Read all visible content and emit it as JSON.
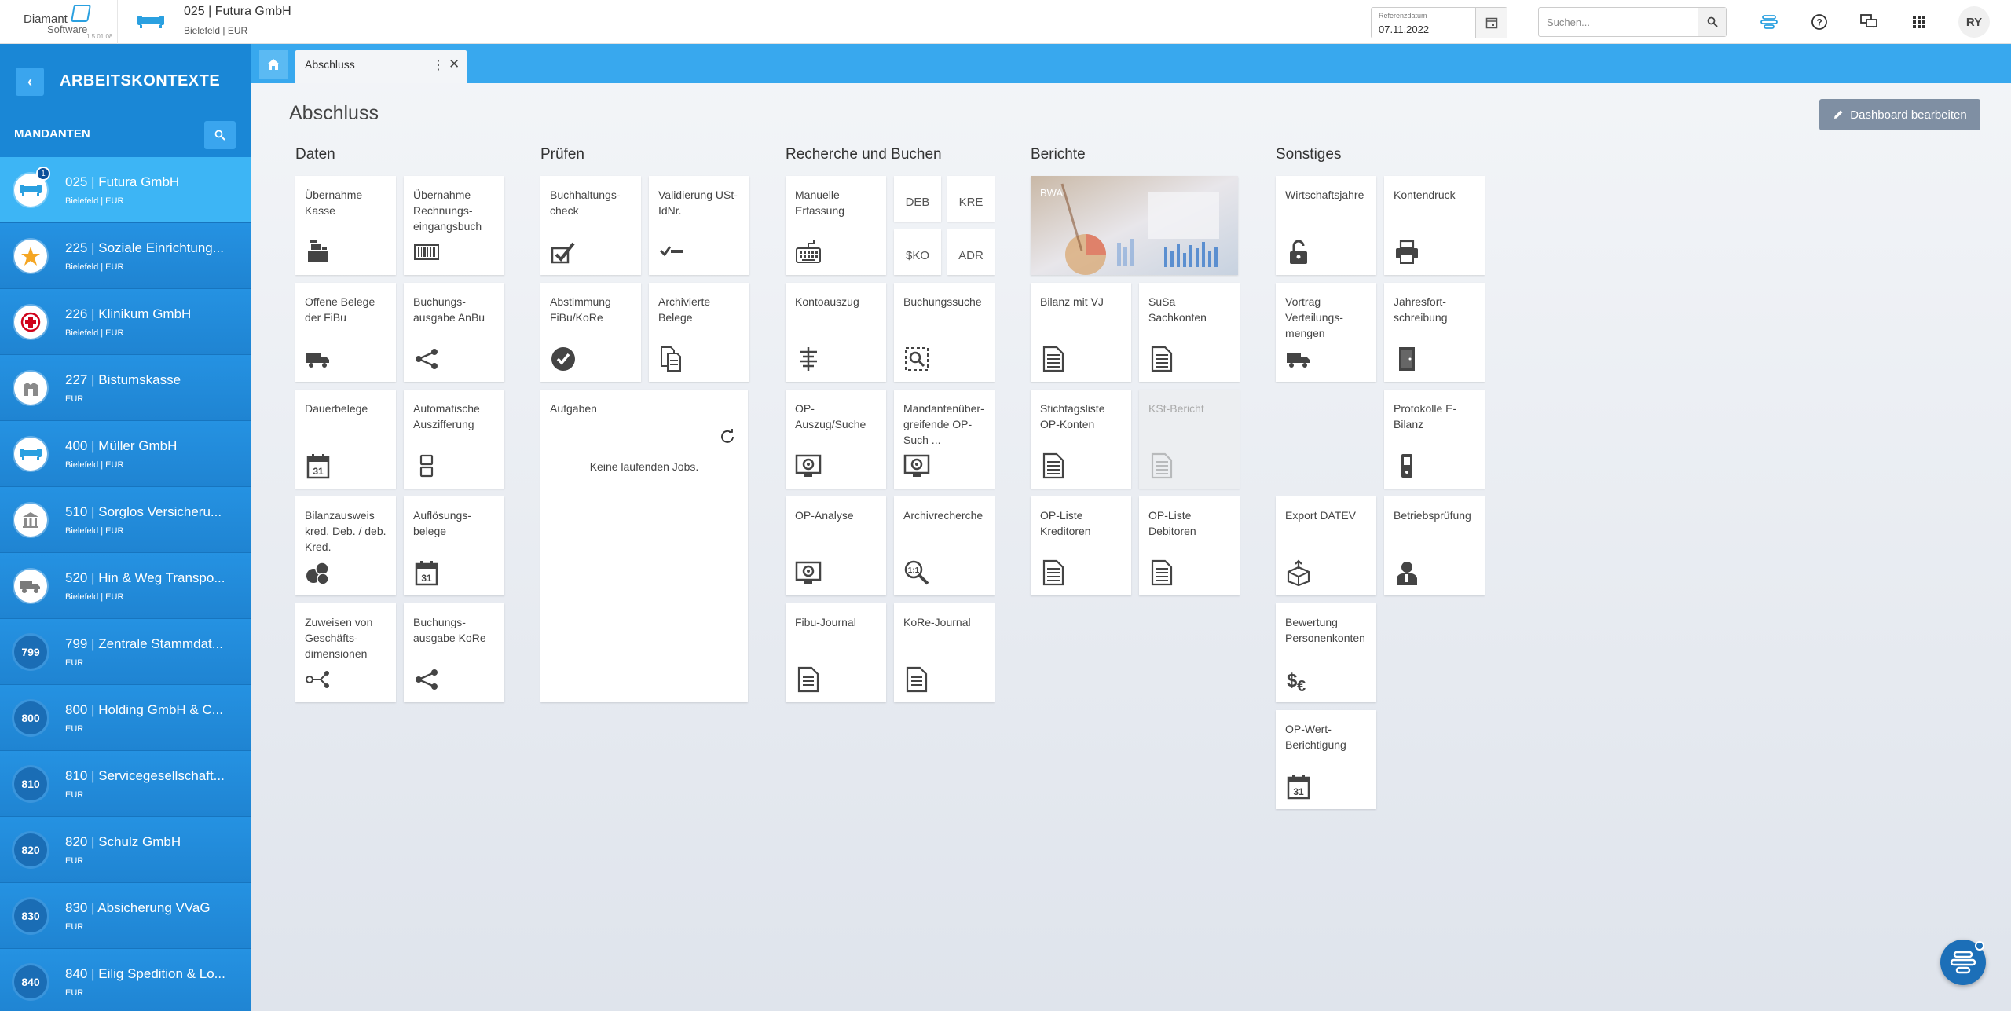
{
  "topbar": {
    "logo_line1": "Diamant",
    "logo_line2": "Software",
    "version": "1.5.01.08",
    "context_name": "025 | Futura GmbH",
    "context_sub": "Bielefeld | EUR",
    "ref_date_label": "Referenzdatum",
    "ref_date_value": "07.11.2022",
    "search_placeholder": "Suchen...",
    "avatar": "RY"
  },
  "sidebar": {
    "title": "ARBEITSKONTEXTE",
    "section": "MANDANTEN",
    "items": [
      {
        "label": "025 | Futura GmbH",
        "sub": "Bielefeld | EUR",
        "icon": "sofa-icon",
        "badge": "1"
      },
      {
        "label": "225 | Soziale Einrichtung...",
        "sub": "Bielefeld | EUR",
        "icon": "star-icon"
      },
      {
        "label": "226 | Klinikum GmbH",
        "sub": "Bielefeld | EUR",
        "icon": "medical-cross-icon"
      },
      {
        "label": "227 | Bistumskasse",
        "sub": "EUR",
        "icon": "church-icon"
      },
      {
        "label": "400 | Müller GmbH",
        "sub": "Bielefeld | EUR",
        "icon": "sofa-icon"
      },
      {
        "label": "510 | Sorglos Versicheru...",
        "sub": "Bielefeld | EUR",
        "icon": "bank-icon"
      },
      {
        "label": "520 | Hin & Weg Transpo...",
        "sub": "Bielefeld | EUR",
        "icon": "truck-icon"
      },
      {
        "label": "799 | Zentrale Stammdat...",
        "sub": "EUR",
        "num": "799"
      },
      {
        "label": "800 | Holding GmbH & C...",
        "sub": "EUR",
        "num": "800"
      },
      {
        "label": "810 | Servicegesellschaft...",
        "sub": "EUR",
        "num": "810"
      },
      {
        "label": "820 | Schulz GmbH",
        "sub": "EUR",
        "num": "820"
      },
      {
        "label": "830 | Absicherung VVaG",
        "sub": "EUR",
        "num": "830"
      },
      {
        "label": "840 | Eilig Spedition & Lo...",
        "sub": "EUR",
        "num": "840"
      }
    ]
  },
  "tabs": {
    "active": "Abschluss"
  },
  "page": {
    "title": "Abschluss",
    "edit_button": "Dashboard bearbeiten"
  },
  "sections": {
    "daten": {
      "title": "Daten",
      "tiles": [
        {
          "label": "Übernahme Kasse",
          "icon": "cash-register-icon"
        },
        {
          "label": "Übernahme Rechnungs-eingangsbuch",
          "icon": "barcode-icon"
        },
        {
          "label": "Offene Belege der FiBu",
          "icon": "truck-icon"
        },
        {
          "label": "Buchungs-ausgabe AnBu",
          "icon": "share-icon"
        },
        {
          "label": "Dauerbelege",
          "icon": "calendar-icon"
        },
        {
          "label": "Automatische Auszifferung",
          "icon": "split-icon"
        },
        {
          "label": "Bilanzausweis kred. Deb. / deb. Kred.",
          "icon": "coins-icon"
        },
        {
          "label": "Auflösungs-belege",
          "icon": "calendar-icon"
        },
        {
          "label": "Zuweisen von Geschäfts-dimensionen",
          "icon": "network-icon"
        },
        {
          "label": "Buchungs-ausgabe KoRe",
          "icon": "share-icon"
        }
      ]
    },
    "pruefen": {
      "title": "Prüfen",
      "tiles": [
        {
          "label": "Buchhaltungs-check",
          "icon": "check-edit-icon"
        },
        {
          "label": "Validierung USt-IdNr.",
          "icon": "check-line-icon"
        },
        {
          "label": "Abstimmung FiBu/KoRe",
          "icon": "check-circle-icon"
        },
        {
          "label": "Archivierte Belege",
          "icon": "documents-icon"
        }
      ],
      "tasks_title": "Aufgaben",
      "tasks_empty": "Keine laufenden Jobs."
    },
    "recherche": {
      "title": "Recherche und Buchen",
      "tiles": [
        {
          "label": "Manuelle Erfassung",
          "icon": "keyboard-icon"
        },
        {
          "label": "Kontoauszug",
          "icon": "statement-icon"
        },
        {
          "label": "Buchungssuche",
          "icon": "search-doc-icon"
        },
        {
          "label": "OP-Auszug/Suche",
          "icon": "monitor-icon"
        },
        {
          "label": "Mandantenüber-greifende OP-Such ...",
          "icon": "monitor-icon"
        },
        {
          "label": "OP-Analyse",
          "icon": "monitor-icon"
        },
        {
          "label": "Archivrecherche",
          "icon": "magnifier-icon"
        },
        {
          "label": "Fibu-Journal",
          "icon": "document-icon"
        },
        {
          "label": "KoRe-Journal",
          "icon": "document-icon"
        }
      ],
      "small": [
        "DEB",
        "KRE",
        "$KO",
        "ADR"
      ]
    },
    "berichte": {
      "title": "Berichte",
      "bwa": "BWA",
      "tiles": [
        {
          "label": "Bilanz mit VJ",
          "icon": "report-icon"
        },
        {
          "label": "SuSa Sachkonten",
          "icon": "report-icon"
        },
        {
          "label": "Stichtagsliste OP-Konten",
          "icon": "report-icon"
        },
        {
          "label": "KSt-Bericht",
          "icon": "report-icon"
        },
        {
          "label": "OP-Liste Kreditoren",
          "icon": "report-icon"
        },
        {
          "label": "OP-Liste Debitoren",
          "icon": "report-icon"
        }
      ]
    },
    "sonstiges": {
      "title": "Sonstiges",
      "tiles": [
        {
          "label": "Wirtschaftsjahre",
          "icon": "unlock-icon"
        },
        {
          "label": "Kontendruck",
          "icon": "printer-icon"
        },
        {
          "label": "Vortrag Verteilungs-mengen",
          "icon": "truck-icon"
        },
        {
          "label": "Jahresfort-schreibung",
          "icon": "door-icon"
        },
        {
          "label": "Protokolle E-Bilanz",
          "icon": "phone-icon"
        },
        {
          "label": "Export DATEV",
          "icon": "box-icon"
        },
        {
          "label": "Betriebsprüfung",
          "icon": "person-icon"
        },
        {
          "label": "Bewertung Personenkonten",
          "icon": "currency-icon"
        },
        {
          "label": "OP-Wert-Berichtigung",
          "icon": "calendar-icon"
        }
      ]
    }
  }
}
